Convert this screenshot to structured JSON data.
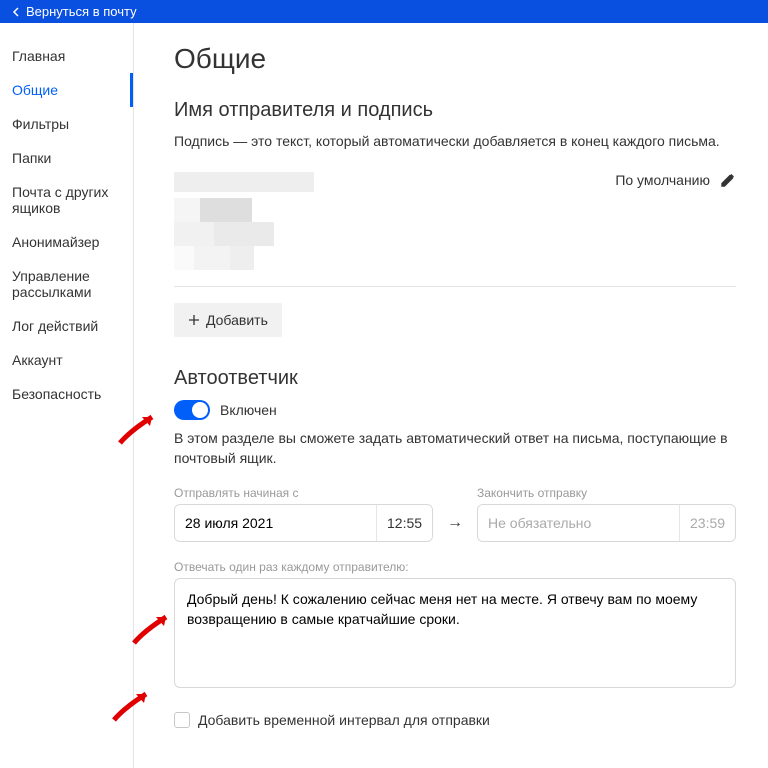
{
  "topbar": {
    "back_label": "Вернуться в почту"
  },
  "sidebar": {
    "items": [
      {
        "label": "Главная"
      },
      {
        "label": "Общие"
      },
      {
        "label": "Фильтры"
      },
      {
        "label": "Папки"
      },
      {
        "label": "Почта с других ящиков"
      },
      {
        "label": "Анонимайзер"
      },
      {
        "label": "Управление рассылками"
      },
      {
        "label": "Лог действий"
      },
      {
        "label": "Аккаунт"
      },
      {
        "label": "Безопасность"
      }
    ]
  },
  "page": {
    "title": "Общие",
    "sender_section": {
      "heading": "Имя отправителя и подпись",
      "description": "Подпись — это текст, который автоматически добавляется в конец каждого письма.",
      "default_label": "По умолчанию",
      "add_button": "Добавить"
    },
    "autoresponder": {
      "heading": "Автоответчик",
      "enabled_label": "Включен",
      "description": "В этом разделе вы сможете задать автоматический ответ на письма, поступающие в почтовый ящик.",
      "start_label": "Отправлять начиная с",
      "start_date": "28 июля 2021",
      "start_time": "12:55",
      "end_label": "Закончить отправку",
      "end_date_placeholder": "Не обязательно",
      "end_time": "23:59",
      "once_label": "Отвечать один раз каждому отправителю:",
      "message": "Добрый день! К сожалению сейчас меня нет на месте. Я отвечу вам по моему возвращению в самые кратчайшие сроки.",
      "add_interval_label": "Добавить временной интервал для отправки"
    }
  }
}
